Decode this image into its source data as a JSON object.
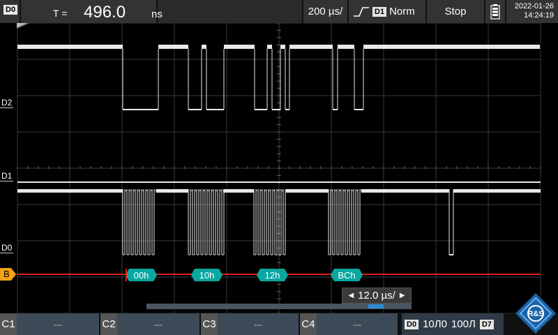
{
  "top_bar": {
    "channel_tag": "D0",
    "measure_label": "T =",
    "measure_value": "496.0",
    "measure_unit": "ns",
    "timebase": "200 µs/",
    "trigger_source": "D1",
    "trigger_mode": "Norm",
    "run_state": "Stop",
    "date": "2022-01-26",
    "time": "14:24:19"
  },
  "channels": {
    "d2_label": "D2",
    "d1_label": "D1",
    "d0_label": "D0",
    "bus_label": "B"
  },
  "decode": [
    "00h",
    "10h",
    "12h",
    "BCh"
  ],
  "zoom_timebase": "12.0 µs/",
  "bottom_bar": {
    "c1": "C1",
    "c1_val": "---",
    "c2": "C2",
    "c2_val": "---",
    "c3": "C3",
    "c3_val": "---",
    "c4": "C4",
    "c4_val": "---",
    "dig_start": "D0",
    "dig_low": "10Л0",
    "dig_high": "100Л",
    "dig_end": "D7"
  },
  "logo_text": "R&S",
  "colors": {
    "bus": "#e0201c",
    "decode": "#0aa7a1",
    "grid": "#3a3a3a",
    "accent": "#2b8bd6",
    "bus_tag": "#f5a015"
  }
}
